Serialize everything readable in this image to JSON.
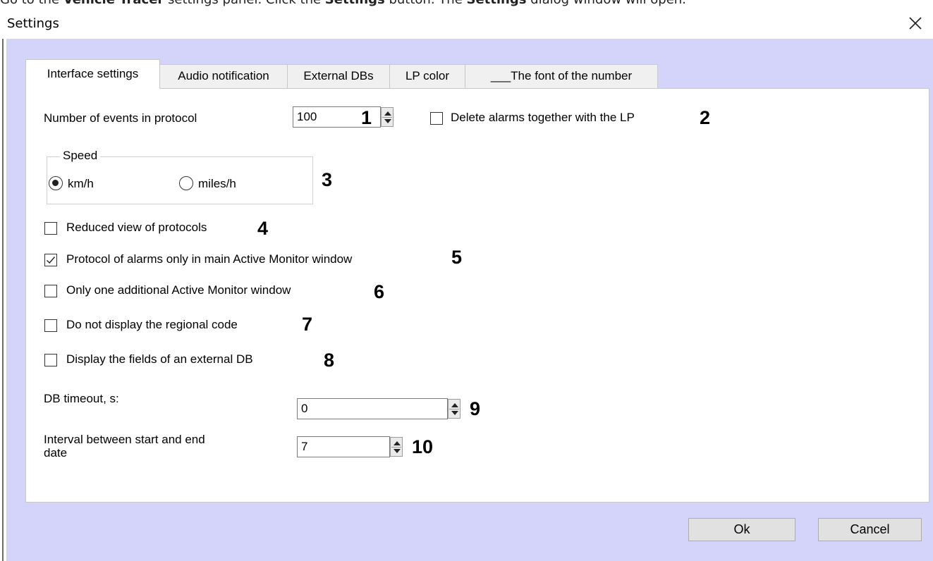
{
  "instruction": {
    "prefix": "Go to the ",
    "panel_name": "Vehicle Tracer",
    "middle": " settings panel. Click the ",
    "button_name": "Settings",
    "middle2": " button. The ",
    "dialog_name": "Settings",
    "suffix": " dialog window will open."
  },
  "window": {
    "title": "Settings",
    "close_icon": "close-icon"
  },
  "tabs": [
    {
      "label": "Interface settings",
      "active": true
    },
    {
      "label": "Audio notification",
      "active": false
    },
    {
      "label": "External DBs",
      "active": false
    },
    {
      "label": "LP color",
      "active": false
    },
    {
      "label": "___The font of the number",
      "active": false
    }
  ],
  "interface": {
    "events_label": "Number of events in protocol",
    "events_value": "100",
    "delete_alarms_label": "Delete alarms together with the LP",
    "delete_alarms_checked": false,
    "speed_group_title": "Speed",
    "speed_kmh": "km/h",
    "speed_miles": "miles/h",
    "speed_selected": "km/h",
    "reduced_view_label": "Reduced view of protocols",
    "reduced_view_checked": false,
    "protocol_alarms_label": "Protocol of alarms only in main Active Monitor window",
    "protocol_alarms_checked": true,
    "one_monitor_label": "Only one additional Active Monitor window",
    "one_monitor_checked": false,
    "regional_code_label": "Do not display the regional code",
    "regional_code_checked": false,
    "external_db_label": "Display the fields of an external DB",
    "external_db_checked": false,
    "db_timeout_label": "DB timeout, s:",
    "db_timeout_value": "0",
    "interval_label_line1": "Interval between start and end",
    "interval_label_line2": "date",
    "interval_value": "7"
  },
  "callouts": [
    "1",
    "2",
    "3",
    "4",
    "5",
    "6",
    "7",
    "8",
    "9",
    "10"
  ],
  "buttons": {
    "ok": "Ok",
    "cancel": "Cancel"
  }
}
